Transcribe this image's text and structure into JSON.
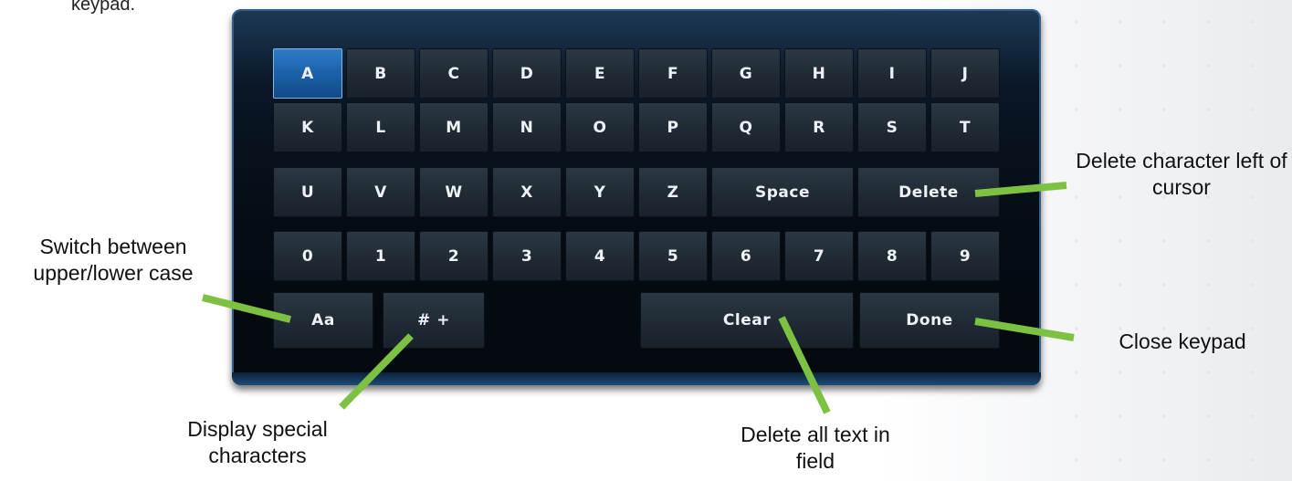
{
  "intro_text": "keypad.",
  "keypad": {
    "rows": [
      [
        "A",
        "B",
        "C",
        "D",
        "E",
        "F",
        "G",
        "H",
        "I",
        "J"
      ],
      [
        "K",
        "L",
        "M",
        "N",
        "O",
        "P",
        "Q",
        "R",
        "S",
        "T"
      ],
      [
        "U",
        "V",
        "W",
        "X",
        "Y",
        "Z",
        "Space",
        "Delete"
      ],
      [
        "0",
        "1",
        "2",
        "3",
        "4",
        "5",
        "6",
        "7",
        "8",
        "9"
      ],
      [
        "Aa",
        "# +",
        "Clear",
        "Done"
      ]
    ],
    "selected_key": "A"
  },
  "annotations": {
    "delete": "Delete character left of cursor",
    "case": "Switch between upper/lower case",
    "special": "Display special characters",
    "clear": "Delete all text in field",
    "close": "Close keypad"
  },
  "colors": {
    "callout_line": "#7cc142",
    "key_face": "#222d37",
    "key_selected": "#1a5fa7",
    "frame_border": "#2f5e89"
  }
}
